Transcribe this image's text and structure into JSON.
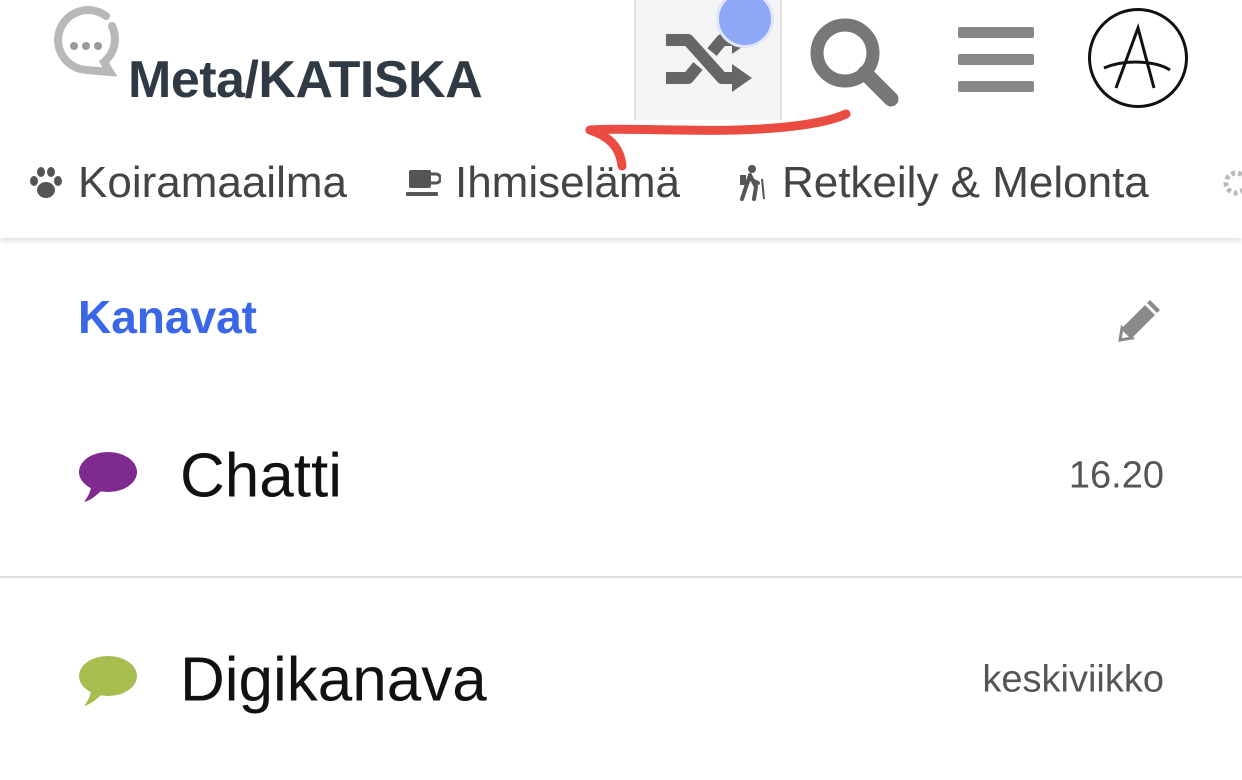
{
  "header": {
    "logo_text": "Meta/KATISKA",
    "icons": {
      "logo": "chat-dots-logo-icon",
      "shuffle": "shuffle-icon",
      "search": "search-icon",
      "menu": "hamburger-menu-icon",
      "avatar": "anarchy-a-avatar"
    }
  },
  "categories": [
    {
      "label": "Koiramaailma",
      "icon": "paw-icon"
    },
    {
      "label": "Ihmiselämä",
      "icon": "coffee-icon"
    },
    {
      "label": "Retkeily & Melonta",
      "icon": "hiking-icon"
    }
  ],
  "section": {
    "title": "Kanavat",
    "edit_icon": "pencil-icon"
  },
  "channels": [
    {
      "name": "Chatti",
      "time": "16.20",
      "color": "#7e2a8f"
    },
    {
      "name": "Digikanava",
      "time": "keskiviikko",
      "color": "#a6bd4f"
    }
  ],
  "colors": {
    "accent": "#3a66e8",
    "notification_dot": "#8fa8f5",
    "annotation_scribble": "#e8392c"
  }
}
